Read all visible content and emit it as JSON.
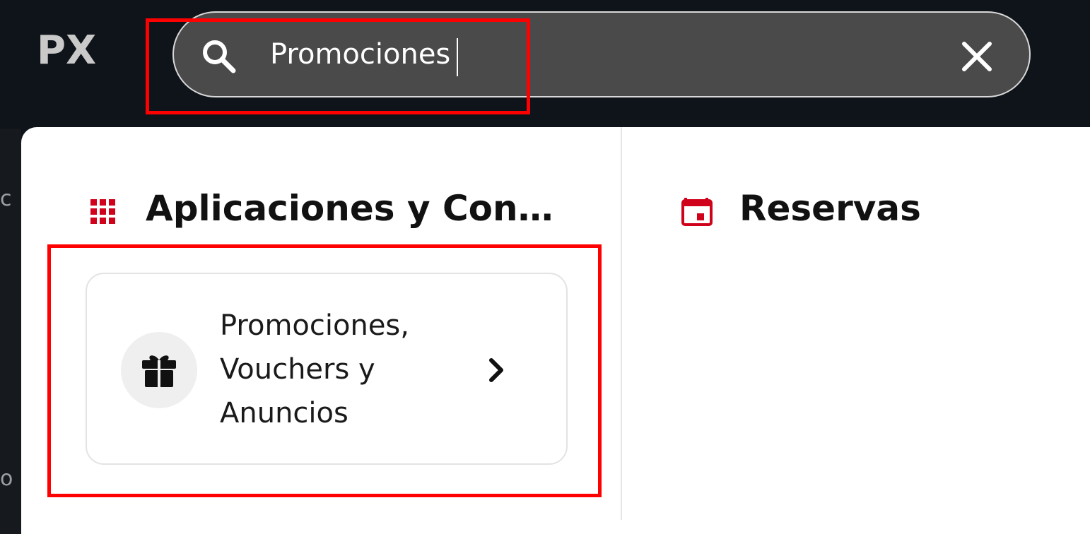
{
  "app": {
    "logo_text": "PX"
  },
  "search": {
    "value": "Promociones",
    "icon": "search-icon",
    "clear_icon": "close-icon"
  },
  "sections": [
    {
      "title": "Aplicaciones y Configuración",
      "title_display": "Aplicaciones y Confi...",
      "icon": "apps-grid-icon",
      "items": [
        {
          "icon": "gift-icon",
          "label_lines": [
            "Promociones,",
            "Vouchers y",
            "Anuncios"
          ]
        }
      ]
    },
    {
      "title": "Reservas",
      "icon": "calendar-icon",
      "items": []
    }
  ],
  "background_strip": {
    "letters": [
      "c",
      "o"
    ]
  },
  "colors": {
    "accent": "#d0021b",
    "highlight": "#ff0000",
    "topbar": "#0f141a",
    "search_bg": "#4a4a4a"
  }
}
